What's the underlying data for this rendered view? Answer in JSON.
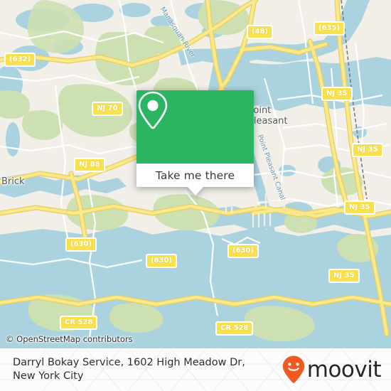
{
  "map": {
    "provider_attribution": "© OpenStreetMap contributors",
    "colors": {
      "land": "#f2efe9",
      "water": "#aad3df",
      "green_area": "#cde0b2",
      "road_major": "#f7e06e",
      "road_minor": "#ffffff",
      "shield_fill": "#f8e14c",
      "shield_text": "#ffffff"
    },
    "city_labels": [
      {
        "name": "Brick",
        "text": "Brick"
      },
      {
        "name": "Point-Pleasant",
        "line1": "Point",
        "line2": "Pleasant"
      }
    ],
    "water_labels": [
      {
        "name": "manasquan-river",
        "text": "Manasquan River"
      },
      {
        "name": "point-pleasant-canal",
        "text": "Point Pleasant Canal"
      }
    ],
    "road_shields": [
      {
        "id": "shield-632",
        "label": "(632)"
      },
      {
        "id": "shield-48",
        "label": "(48)"
      },
      {
        "id": "shield-635",
        "label": "(635)"
      },
      {
        "id": "shield-nj70",
        "label": "NJ 70"
      },
      {
        "id": "shield-nj35-a",
        "label": "NJ 35"
      },
      {
        "id": "shield-nj35-b",
        "label": "NJ 35"
      },
      {
        "id": "shield-nj88",
        "label": "NJ 88"
      },
      {
        "id": "shield-nj35-c",
        "label": "NJ 35"
      },
      {
        "id": "shield-nj35-d",
        "label": "NJ 35"
      },
      {
        "id": "shield-630-a",
        "label": "(630)"
      },
      {
        "id": "shield-630-b",
        "label": "(630)"
      },
      {
        "id": "shield-630-c",
        "label": "(630)"
      },
      {
        "id": "shield-cr528-a",
        "label": "CR 528"
      },
      {
        "id": "shield-cr528-b",
        "label": "CR 528"
      }
    ]
  },
  "callout": {
    "header_color": "#2bb462",
    "pin_icon": "location-pin-icon",
    "action_label": "Take me there"
  },
  "footer": {
    "title": "Darryl Bokay Service, 1602 High Meadow Dr, New York City",
    "brand_name": "moovit",
    "brand_color": "#ef5a22",
    "brand_text_color": "#25282b"
  }
}
